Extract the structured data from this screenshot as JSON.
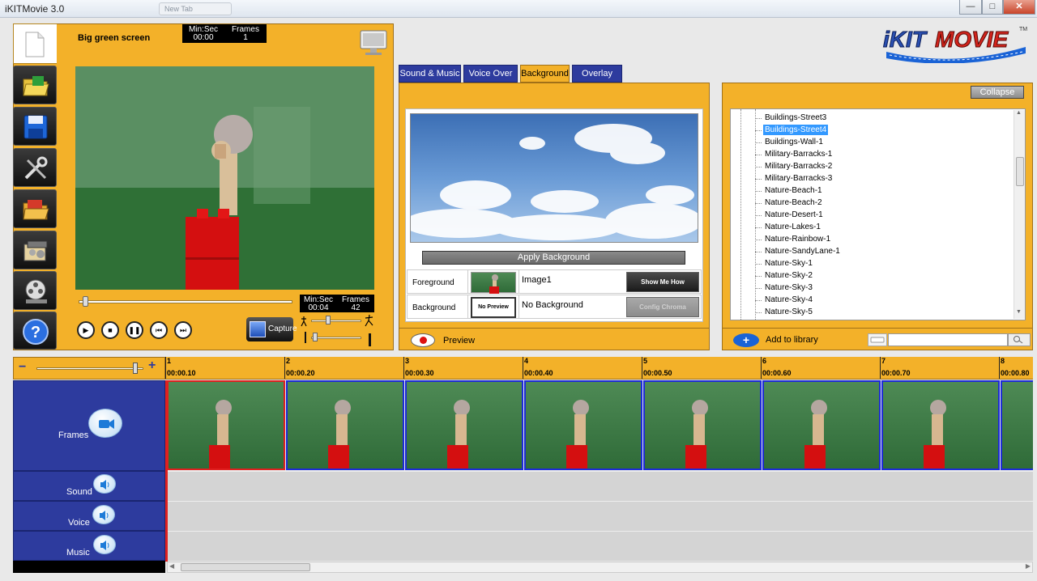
{
  "window": {
    "title": "iKITMovie 3.0",
    "ghost_tab": "New Tab",
    "minimize": "—",
    "maximize": "□",
    "close": "✕"
  },
  "logo": {
    "text": "iKITMOVIE",
    "tm": "TM"
  },
  "capture": {
    "project_name": "Big green screen",
    "counter_top": {
      "label_left": "Min:Sec",
      "label_right": "Frames",
      "time": "00:00",
      "frames": "1"
    },
    "counter_bottom": {
      "label_left": "Min:Sec",
      "label_right": "Frames",
      "time": "00:04",
      "frames": "42"
    },
    "capture_label": "Capture",
    "scrub_progress": 0.02,
    "sidebar_icons": [
      "folder-open-icon",
      "save-icon",
      "tools-icon",
      "folder-projects-icon",
      "film-clapper-icon",
      "film-reel-icon",
      "help-icon"
    ],
    "help_glyph": "?"
  },
  "tabs": [
    {
      "label": "Sound & Music",
      "active": false
    },
    {
      "label": "Voice Over",
      "active": false
    },
    {
      "label": "Background",
      "active": true
    },
    {
      "label": "Overlay",
      "active": false
    }
  ],
  "background_panel": {
    "apply_label": "Apply Background",
    "rows": [
      {
        "label": "Foreground",
        "value": "Image1",
        "button": "Show Me How",
        "thumb_text": ""
      },
      {
        "label": "Background",
        "value": "No Background",
        "button": "Config Chroma",
        "thumb_text": "No Preview"
      }
    ],
    "preview_label": "Preview"
  },
  "library": {
    "collapse_label": "Collapse",
    "items": [
      {
        "label": "Buildings-Street3",
        "selected": false
      },
      {
        "label": "Buildings-Street4",
        "selected": true
      },
      {
        "label": "Buildings-Wall-1",
        "selected": false
      },
      {
        "label": "Military-Barracks-1",
        "selected": false
      },
      {
        "label": "Military-Barracks-2",
        "selected": false
      },
      {
        "label": "Military-Barracks-3",
        "selected": false
      },
      {
        "label": "Nature-Beach-1",
        "selected": false
      },
      {
        "label": "Nature-Beach-2",
        "selected": false
      },
      {
        "label": "Nature-Desert-1",
        "selected": false
      },
      {
        "label": "Nature-Lakes-1",
        "selected": false
      },
      {
        "label": "Nature-Rainbow-1",
        "selected": false
      },
      {
        "label": "Nature-SandyLane-1",
        "selected": false
      },
      {
        "label": "Nature-Sky-1",
        "selected": false
      },
      {
        "label": "Nature-Sky-2",
        "selected": false
      },
      {
        "label": "Nature-Sky-3",
        "selected": false
      },
      {
        "label": "Nature-Sky-4",
        "selected": false
      },
      {
        "label": "Nature-Sky-5",
        "selected": false
      }
    ],
    "add_label": "Add to library",
    "search_placeholder": ""
  },
  "timeline": {
    "zoom_minus": "−",
    "zoom_plus": "+",
    "zoom_level": 0.9,
    "ticks": [
      {
        "n": "1",
        "t": "00:00.10"
      },
      {
        "n": "2",
        "t": "00:00.20"
      },
      {
        "n": "3",
        "t": "00:00.30"
      },
      {
        "n": "4",
        "t": "00:00.40"
      },
      {
        "n": "5",
        "t": "00:00.50"
      },
      {
        "n": "6",
        "t": "00:00.60"
      },
      {
        "n": "7",
        "t": "00:00.70"
      },
      {
        "n": "8",
        "t": "00:00.80"
      }
    ],
    "tracks": {
      "frames": "Frames",
      "sound": "Sound",
      "voice": "Voice",
      "music": "Music"
    },
    "frame_count_visible": 8,
    "selected_frame": 1
  },
  "colors": {
    "panel_orange": "#f3b129",
    "track_blue": "#2d3b9e",
    "frame_border_blue": "#1d2bd8",
    "selection_red": "#e02020",
    "tree_selection": "#3399ff"
  }
}
